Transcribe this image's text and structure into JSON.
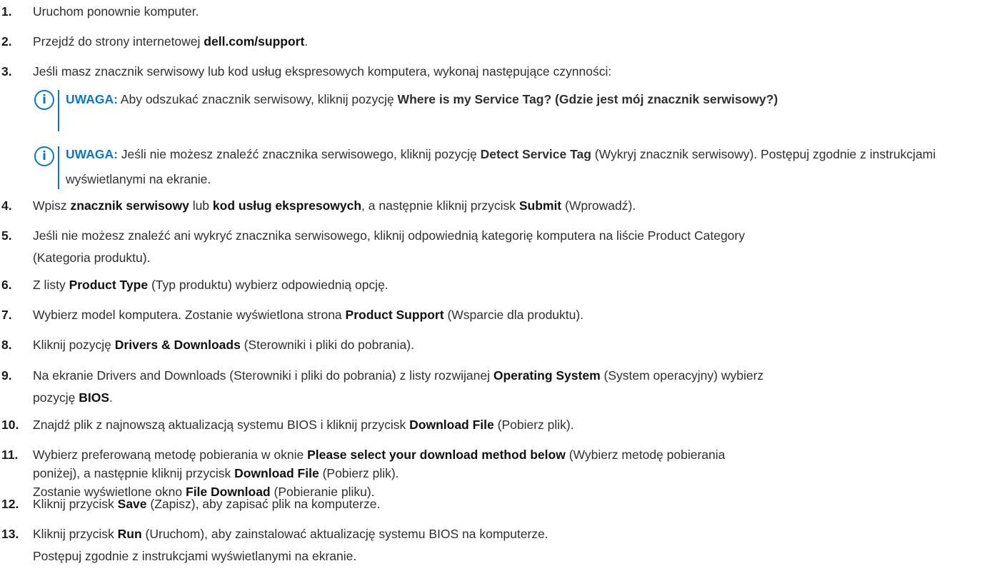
{
  "steps": [
    {
      "num": "1.",
      "parts": [
        {
          "t": "Uruchom ponownie komputer."
        }
      ]
    },
    {
      "num": "2.",
      "parts": [
        {
          "t": "Przejdź do strony internetowej "
        },
        {
          "t": "dell.com/support",
          "b": true
        },
        {
          "t": "."
        }
      ]
    },
    {
      "num": "3.",
      "parts": [
        {
          "t": "Jeśli masz znacznik serwisowy lub kod usług ekspresowych komputera, wykonaj następujące czynności:"
        }
      ]
    },
    {
      "num": "4.",
      "parts": [
        {
          "t": "Wpisz "
        },
        {
          "t": "znacznik serwisowy",
          "b": true
        },
        {
          "t": " lub "
        },
        {
          "t": "kod usług ekspresowych",
          "b": true
        },
        {
          "t": ", a następnie kliknij przycisk "
        },
        {
          "t": "Submit",
          "b": true
        },
        {
          "t": " (Wprowadź)."
        }
      ]
    },
    {
      "num": "5.",
      "parts": [
        {
          "t": "Jeśli nie możesz znaleźć ani wykryć znacznika serwisowego, kliknij odpowiednią kategorię komputera na liście Product Category"
        }
      ],
      "cont": [
        {
          "t": "(Kategoria produktu)."
        }
      ]
    },
    {
      "num": "6.",
      "parts": [
        {
          "t": "Z listy "
        },
        {
          "t": "Product Type",
          "b": true
        },
        {
          "t": " (Typ produktu) wybierz odpowiednią opcję."
        }
      ]
    },
    {
      "num": "7.",
      "parts": [
        {
          "t": "Wybierz model komputera. Zostanie wyświetlona strona "
        },
        {
          "t": "Product Support",
          "b": true
        },
        {
          "t": " (Wsparcie dla produktu)."
        }
      ]
    },
    {
      "num": "8.",
      "parts": [
        {
          "t": "Kliknij pozycję "
        },
        {
          "t": "Drivers & Downloads",
          "b": true
        },
        {
          "t": " (Sterowniki i pliki do pobrania)."
        }
      ]
    },
    {
      "num": "9.",
      "parts": [
        {
          "t": "Na ekranie Drivers and Downloads (Sterowniki i pliki do pobrania) z listy rozwijanej "
        },
        {
          "t": "Operating System",
          "b": true
        },
        {
          "t": " (System operacyjny) wybierz"
        }
      ],
      "cont": [
        {
          "t": "pozycję "
        },
        {
          "t": "BIOS",
          "b": true
        },
        {
          "t": "."
        }
      ]
    },
    {
      "num": "10.",
      "parts": [
        {
          "t": "Znajdź plik z najnowszą aktualizacją systemu BIOS i kliknij przycisk "
        },
        {
          "t": "Download File",
          "b": true
        },
        {
          "t": " (Pobierz plik)."
        }
      ]
    },
    {
      "num": "11.",
      "parts": [
        {
          "t": "Wybierz preferowaną metodę pobierania w oknie "
        },
        {
          "t": "Please select your download method below",
          "b": true
        },
        {
          "t": " (Wybierz metodę pobierania"
        }
      ],
      "cont": [
        {
          "t": "poniżej), a następnie kliknij przycisk "
        },
        {
          "t": "Download File",
          "b": true
        },
        {
          "t": " (Pobierz plik)."
        }
      ],
      "cont2": [
        {
          "t": "Zostanie wyświetlone okno "
        },
        {
          "t": "File Download",
          "b": true
        },
        {
          "t": " (Pobieranie pliku)."
        }
      ]
    },
    {
      "num": "12.",
      "parts": [
        {
          "t": "Kliknij przycisk "
        },
        {
          "t": "Save",
          "b": true
        },
        {
          "t": " (Zapisz), aby zapisać plik na komputerze."
        }
      ]
    },
    {
      "num": "13.",
      "parts": [
        {
          "t": "Kliknij przycisk "
        },
        {
          "t": "Run",
          "b": true
        },
        {
          "t": " (Uruchom), aby zainstalować aktualizację systemu BIOS na komputerze."
        }
      ],
      "cont": [
        {
          "t": "Postępuj zgodnie z instrukcjami wyświetlanymi na ekranie."
        }
      ]
    }
  ],
  "notes": [
    {
      "label": "UWAGA:",
      "parts": [
        {
          "t": " Aby odszukać znacznik serwisowy, kliknij pozycję "
        },
        {
          "t": "Where is my Service Tag? (Gdzie jest mój znacznik serwisowy?)",
          "b": true
        }
      ]
    },
    {
      "label": "UWAGA:",
      "parts": [
        {
          "t": " Jeśli nie możesz znaleźć znacznika serwisowego, kliknij pozycję "
        },
        {
          "t": "Detect Service Tag",
          "b": true
        },
        {
          "t": " (Wykryj znacznik serwisowy). Postępuj zgodnie z instrukcjami wyświetlanymi na ekranie."
        }
      ]
    }
  ],
  "icons": {
    "note": "info-icon",
    "note_glyph": "i"
  },
  "colors": {
    "accent": "#0b76c7"
  }
}
